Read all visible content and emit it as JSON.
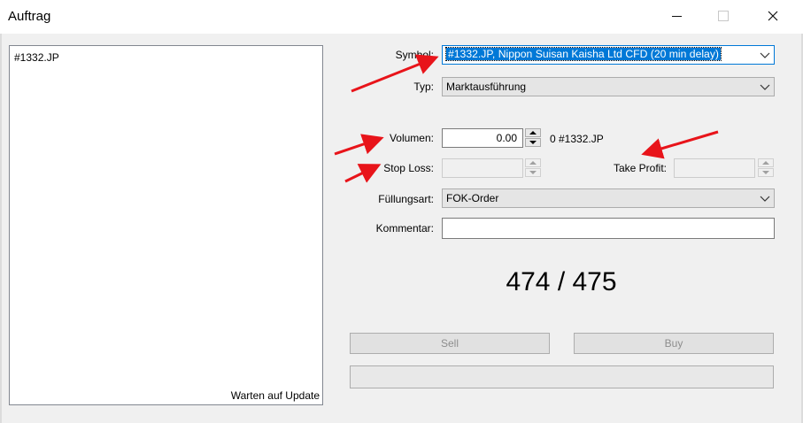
{
  "window": {
    "title": "Auftrag"
  },
  "chart_panel": {
    "symbol": "#1332.JP",
    "status": "Warten auf Update"
  },
  "form": {
    "symbol": {
      "label": "Symbol:",
      "value": "#1332.JP, Nippon Suisan Kaisha Ltd CFD (20 min delay)"
    },
    "type": {
      "label": "Typ:",
      "value": "Marktausführung"
    },
    "volume": {
      "label": "Volumen:",
      "value": "0.00",
      "info": "0 #1332.JP"
    },
    "stop_loss": {
      "label": "Stop Loss:",
      "value": ""
    },
    "take_profit": {
      "label": "Take Profit:",
      "value": ""
    },
    "filling": {
      "label": "Füllungsart:",
      "value": "FOK-Order"
    },
    "comment": {
      "label": "Kommentar:",
      "value": ""
    }
  },
  "quote": {
    "text": "474 / 475"
  },
  "buttons": {
    "sell": "Sell",
    "buy": "Buy"
  },
  "colors": {
    "annotation_arrow": "#e8141a",
    "selection": "#0078d7"
  }
}
